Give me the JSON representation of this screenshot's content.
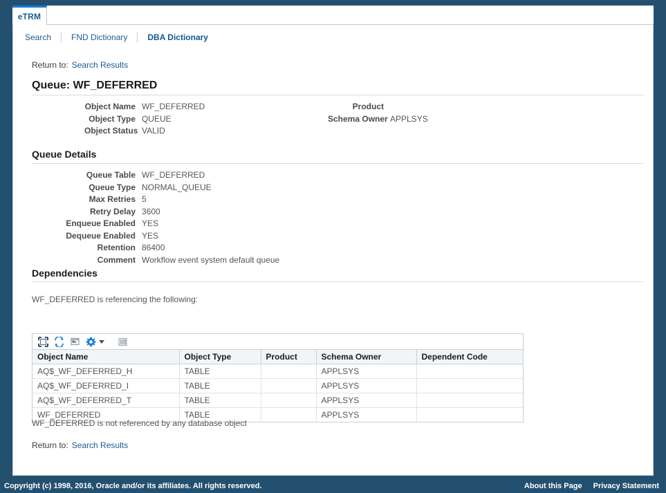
{
  "window": {
    "main_tab_label": "eTRM"
  },
  "subnav": {
    "items": [
      {
        "label": "Search",
        "active": false
      },
      {
        "label": "FND Dictionary",
        "active": false
      },
      {
        "label": "DBA Dictionary",
        "active": true
      }
    ]
  },
  "return_top": {
    "label": "Return to:",
    "link": "Search Results"
  },
  "return_bottom": {
    "label": "Return to:",
    "link": "Search Results"
  },
  "page_title": "Queue: WF_DEFERRED",
  "object_summary": {
    "left": [
      {
        "label": "Object Name",
        "value": "WF_DEFERRED"
      },
      {
        "label": "Object Type",
        "value": "QUEUE"
      },
      {
        "label": "Object Status",
        "value": "VALID"
      }
    ],
    "right": [
      {
        "label": "Product",
        "value": ""
      },
      {
        "label": "Schema Owner",
        "value": "APPLSYS"
      }
    ]
  },
  "queue_details": {
    "title": "Queue Details",
    "rows": [
      {
        "label": "Queue Table",
        "value": "WF_DEFERRED"
      },
      {
        "label": "Queue Type",
        "value": "NORMAL_QUEUE"
      },
      {
        "label": "Max Retries",
        "value": "5"
      },
      {
        "label": "Retry Delay",
        "value": "3600"
      },
      {
        "label": "Enqueue Enabled",
        "value": "YES"
      },
      {
        "label": "Dequeue Enabled",
        "value": "YES"
      },
      {
        "label": "Retention",
        "value": "86400"
      },
      {
        "label": "Comment",
        "value": "Workflow event system default queue"
      }
    ]
  },
  "dependencies": {
    "title": "Dependencies",
    "referencing_text": "WF_DEFERRED is referencing the following:",
    "not_referenced_text": "WF_DEFERRED is not referenced by any database object",
    "toolbar_icons": [
      "expand-all-icon",
      "refresh-icon",
      "detach-icon",
      "gear-icon",
      "dropdown-caret-icon",
      "columns-icon"
    ],
    "columns": [
      "Object Name",
      "Object Type",
      "Product",
      "Schema Owner",
      "Dependent Code"
    ],
    "rows": [
      {
        "object_name": "AQ$_WF_DEFERRED_H",
        "object_type": "TABLE",
        "product": "",
        "schema_owner": "APPLSYS",
        "dependent_code": ""
      },
      {
        "object_name": "AQ$_WF_DEFERRED_I",
        "object_type": "TABLE",
        "product": "",
        "schema_owner": "APPLSYS",
        "dependent_code": ""
      },
      {
        "object_name": "AQ$_WF_DEFERRED_T",
        "object_type": "TABLE",
        "product": "",
        "schema_owner": "APPLSYS",
        "dependent_code": ""
      },
      {
        "object_name": "WF_DEFERRED",
        "object_type": "TABLE",
        "product": "",
        "schema_owner": "APPLSYS",
        "dependent_code": ""
      }
    ]
  },
  "footer": {
    "copyright": "Copyright (c) 1998, 2016, Oracle and/or its affiliates. All rights reserved.",
    "links": [
      {
        "label": "About this Page"
      },
      {
        "label": "Privacy Statement"
      }
    ]
  },
  "colors": {
    "frame": "#24506f",
    "link": "#1a5a96",
    "tab_accent": "#1b7fd4",
    "icon_blue": "#1c7fd0"
  }
}
